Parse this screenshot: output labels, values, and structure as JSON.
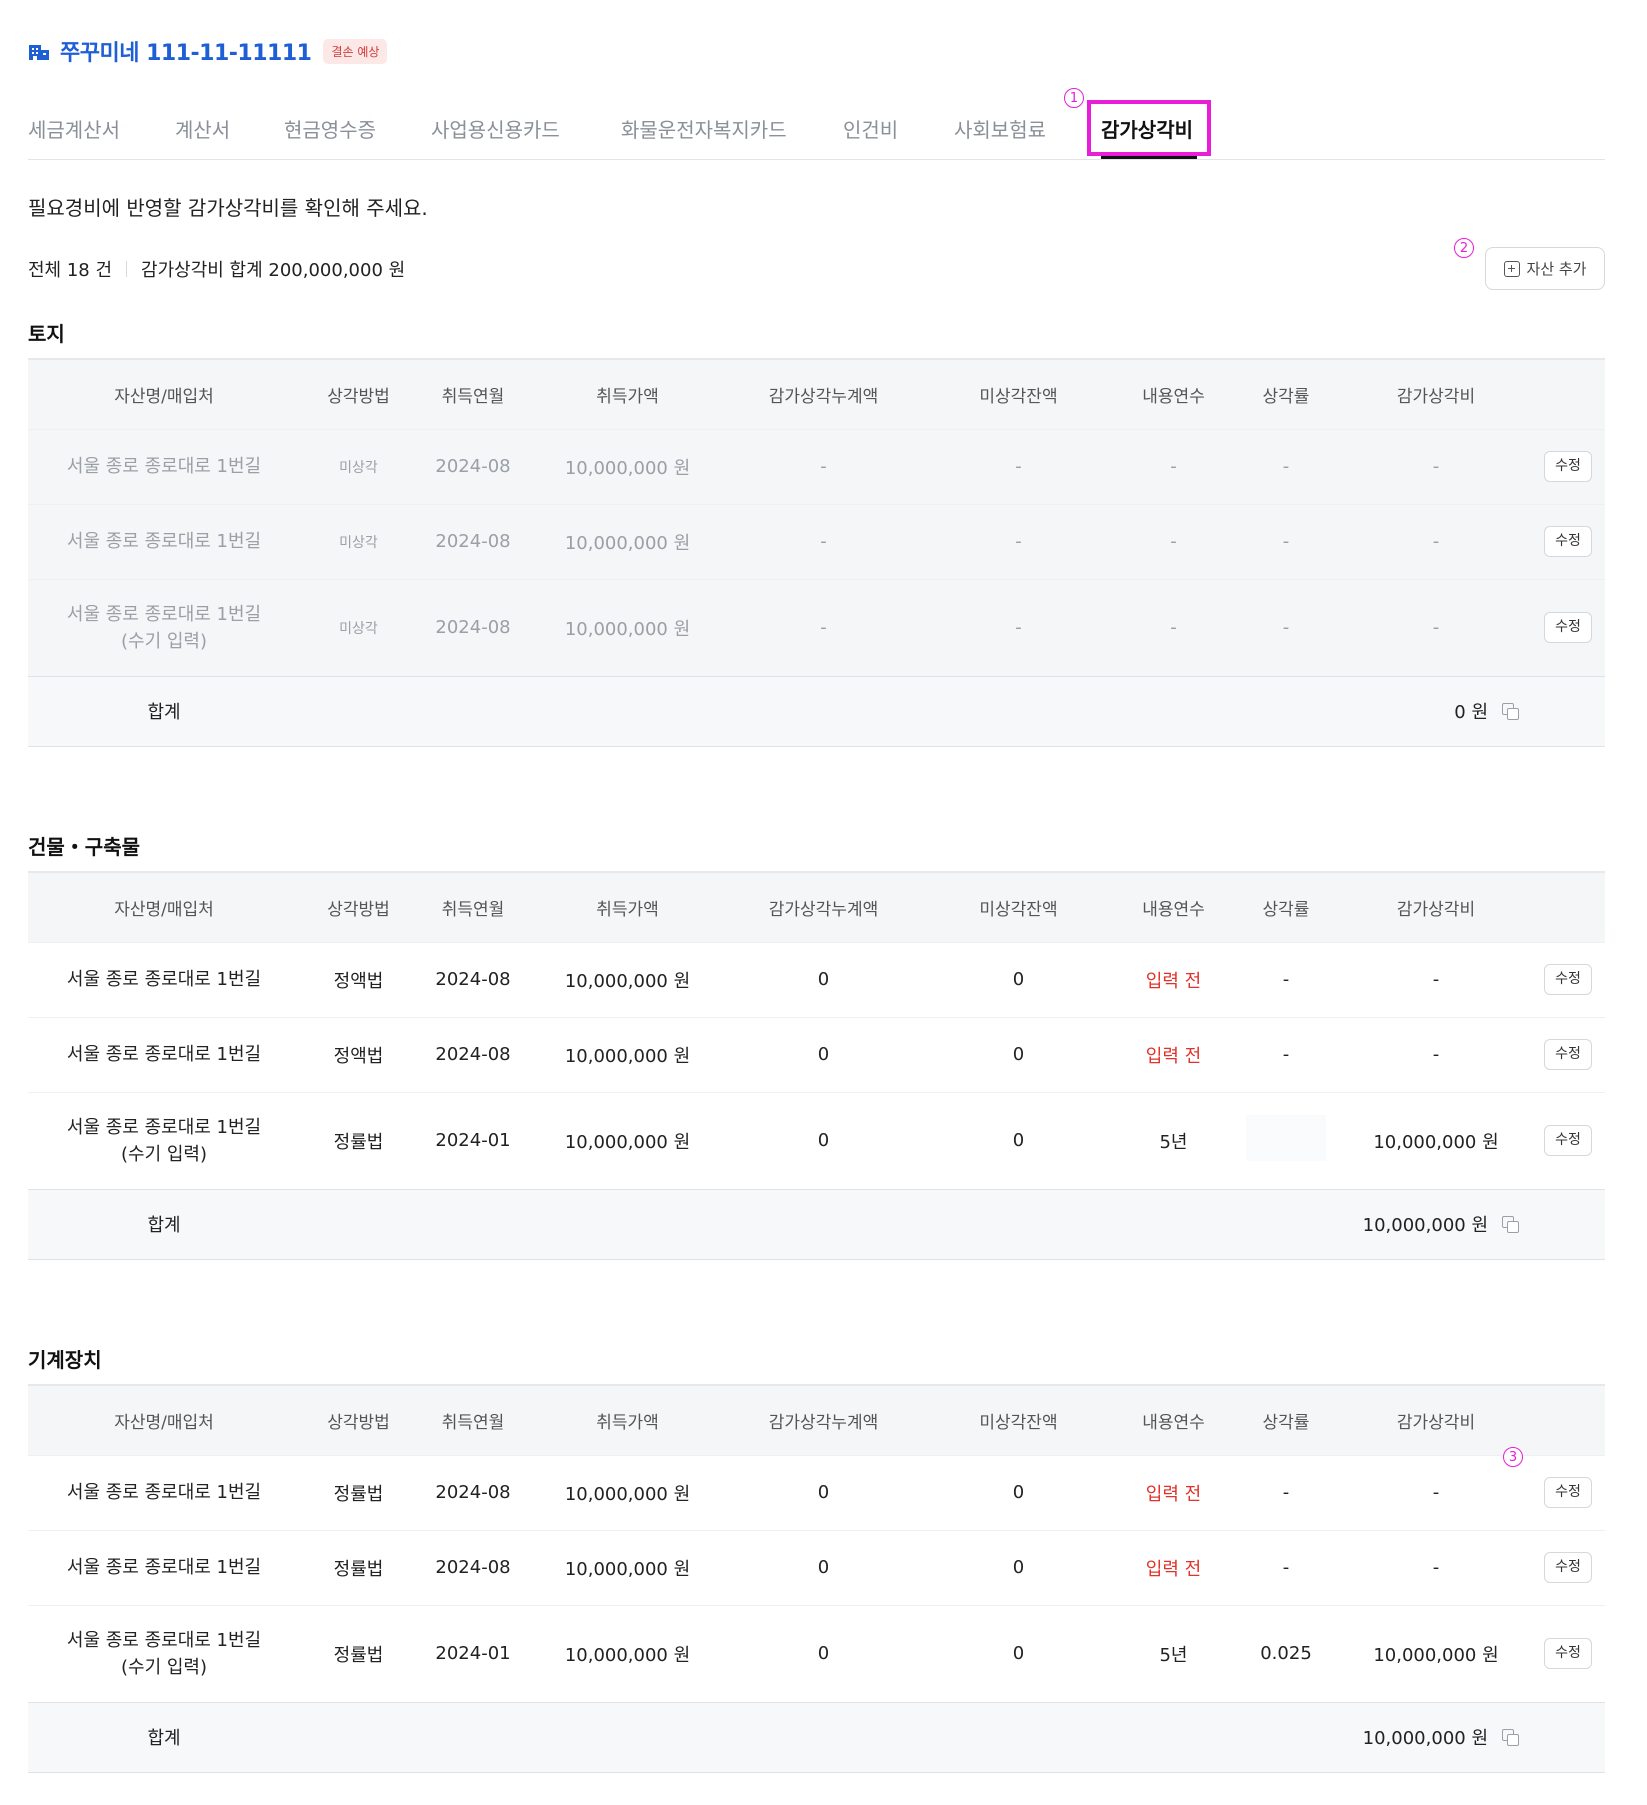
{
  "company": {
    "name": "쭈꾸미네 111-11-11111",
    "badge": "결손 예상"
  },
  "tabs": [
    {
      "label": "세금계산서"
    },
    {
      "label": "계산서"
    },
    {
      "label": "현금영수증"
    },
    {
      "label": "사업용신용카드"
    },
    {
      "label": "화물운전자복지카드"
    },
    {
      "label": "인건비"
    },
    {
      "label": "사회보험료"
    },
    {
      "label": "감가상각비"
    }
  ],
  "description": "필요경비에 반영할 감가상각비를 확인해 주세요.",
  "summary": {
    "count": "전체 18 건",
    "total": "감가상각비 합계 200,000,000 원"
  },
  "add_button": "자산 추가",
  "markers": {
    "m1": "1",
    "m2": "2",
    "m3": "3"
  },
  "columns": [
    "자산명/매입처",
    "상각방법",
    "취득연월",
    "취득가액",
    "감가상각누계액",
    "미상각잔액",
    "내용연수",
    "상각률",
    "감가상각비"
  ],
  "edit_label": "수정",
  "total_label": "합계",
  "sections": [
    {
      "title": "토지",
      "rows": [
        {
          "name": "서울 종로 종로대로 1번길",
          "method": "미상각",
          "date": "2024-08",
          "cost": "10,000,000 원",
          "accum": "-",
          "remain": "-",
          "life": "-",
          "rate": "-",
          "dep": "-"
        },
        {
          "name": "서울 종로 종로대로 1번길",
          "method": "미상각",
          "date": "2024-08",
          "cost": "10,000,000 원",
          "accum": "-",
          "remain": "-",
          "life": "-",
          "rate": "-",
          "dep": "-"
        },
        {
          "name": "서울 종로 종로대로 1번길",
          "name2": "(수기 입력)",
          "method": "미상각",
          "date": "2024-08",
          "cost": "10,000,000 원",
          "accum": "-",
          "remain": "-",
          "life": "-",
          "rate": "-",
          "dep": "-"
        }
      ],
      "total": "0 원"
    },
    {
      "title": "건물・구축물",
      "rows": [
        {
          "name": "서울 종로 종로대로 1번길",
          "method": "정액법",
          "date": "2024-08",
          "cost": "10,000,000 원",
          "accum": "0",
          "remain": "0",
          "life": "입력 전",
          "rate": "-",
          "dep": "-"
        },
        {
          "name": "서울 종로 종로대로 1번길",
          "method": "정액법",
          "date": "2024-08",
          "cost": "10,000,000 원",
          "accum": "0",
          "remain": "0",
          "life": "입력 전",
          "rate": "-",
          "dep": "-"
        },
        {
          "name": "서울 종로 종로대로 1번길",
          "name2": "(수기 입력)",
          "method": "정률법",
          "date": "2024-01",
          "cost": "10,000,000 원",
          "accum": "0",
          "remain": "0",
          "life": "5년",
          "rate": "",
          "dep": "10,000,000 원"
        }
      ],
      "total": "10,000,000 원"
    },
    {
      "title": "기계장치",
      "rows": [
        {
          "name": "서울 종로 종로대로 1번길",
          "method": "정률법",
          "date": "2024-08",
          "cost": "10,000,000 원",
          "accum": "0",
          "remain": "0",
          "life": "입력 전",
          "rate": "-",
          "dep": "-"
        },
        {
          "name": "서울 종로 종로대로 1번길",
          "method": "정률법",
          "date": "2024-08",
          "cost": "10,000,000 원",
          "accum": "0",
          "remain": "0",
          "life": "입력 전",
          "rate": "-",
          "dep": "-"
        },
        {
          "name": "서울 종로 종로대로 1번길",
          "name2": "(수기 입력)",
          "method": "정률법",
          "date": "2024-01",
          "cost": "10,000,000 원",
          "accum": "0",
          "remain": "0",
          "life": "5년",
          "rate": "0.025",
          "dep": "10,000,000 원"
        }
      ],
      "total": "10,000,000 원"
    }
  ],
  "colors": {
    "accent": "#1f5fd6",
    "highlight": "#e81ed8",
    "warning": "#e0332b"
  }
}
